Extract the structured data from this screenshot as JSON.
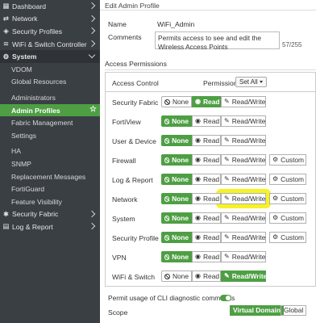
{
  "sidebar": {
    "items": [
      {
        "label": "Dashboard",
        "icon": "dashboard-icon",
        "type": "top",
        "chevron": true
      },
      {
        "label": "Network",
        "icon": "network-icon",
        "type": "top",
        "chevron": true
      },
      {
        "label": "Security Profiles",
        "icon": "shield-icon",
        "type": "top",
        "chevron": true
      },
      {
        "label": "WiFi & Switch Controller",
        "icon": "wifi-icon",
        "type": "top",
        "chevron": true
      },
      {
        "label": "System",
        "icon": "gear-icon",
        "type": "expanded",
        "chevron": true
      },
      {
        "label": "VDOM",
        "type": "sub"
      },
      {
        "label": "Global Resources",
        "type": "sub"
      },
      {
        "label": "Administrators",
        "type": "sub",
        "gap": true
      },
      {
        "label": "Admin Profiles",
        "type": "sub",
        "active": true
      },
      {
        "label": "Fabric Management",
        "type": "sub"
      },
      {
        "label": "Settings",
        "type": "sub"
      },
      {
        "label": "HA",
        "type": "sub",
        "gap": true
      },
      {
        "label": "SNMP",
        "type": "sub"
      },
      {
        "label": "Replacement Messages",
        "type": "sub"
      },
      {
        "label": "FortiGuard",
        "type": "sub"
      },
      {
        "label": "Feature Visibility",
        "type": "sub"
      },
      {
        "label": "Security Fabric",
        "icon": "fabric-icon",
        "type": "top",
        "chevron": true
      },
      {
        "label": "Log & Report",
        "icon": "log-icon",
        "type": "top",
        "chevron": true
      }
    ]
  },
  "panel": {
    "title": "Edit Admin Profile",
    "name_label": "Name",
    "name_value": "WiFi_Admin",
    "comments_label": "Comments",
    "comments_value": "Permits access to see and edit the Wireless Access Points",
    "comments_counter": "57/255",
    "section_title": "Access Permissions"
  },
  "table": {
    "header_access": "Access Control",
    "header_permissions": "Permissions",
    "set_all": "Set All",
    "labels": {
      "none": "None",
      "read": "Read",
      "readwrite": "Read/Write",
      "custom": "Custom"
    },
    "rows": [
      {
        "label": "Security Fabric",
        "selected": "read",
        "custom": false
      },
      {
        "label": "FortiView",
        "selected": "none",
        "custom": false
      },
      {
        "label": "User & Device",
        "selected": "none",
        "custom": false
      },
      {
        "label": "Firewall",
        "selected": "none",
        "custom": true
      },
      {
        "label": "Log & Report",
        "selected": "none",
        "custom": true
      },
      {
        "label": "Network",
        "selected": "none",
        "custom": true,
        "highlight": true
      },
      {
        "label": "System",
        "selected": "none",
        "custom": true
      },
      {
        "label": "Security Profile",
        "selected": "none",
        "custom": true
      },
      {
        "label": "VPN",
        "selected": "none",
        "custom": false
      },
      {
        "label": "WiFi & Switch",
        "selected": "readwrite",
        "custom": false
      }
    ]
  },
  "cli": {
    "label": "Permit usage of CLI diagnostic commands",
    "enabled": true
  },
  "scope": {
    "label": "Scope",
    "option_vdom": "Virtual Domain",
    "option_global": "Global",
    "selected": "Virtual Domain"
  },
  "colors": {
    "accent": "#4e9f44",
    "sidebar_bg": "#3a3f44",
    "highlight": "#f6f224"
  }
}
